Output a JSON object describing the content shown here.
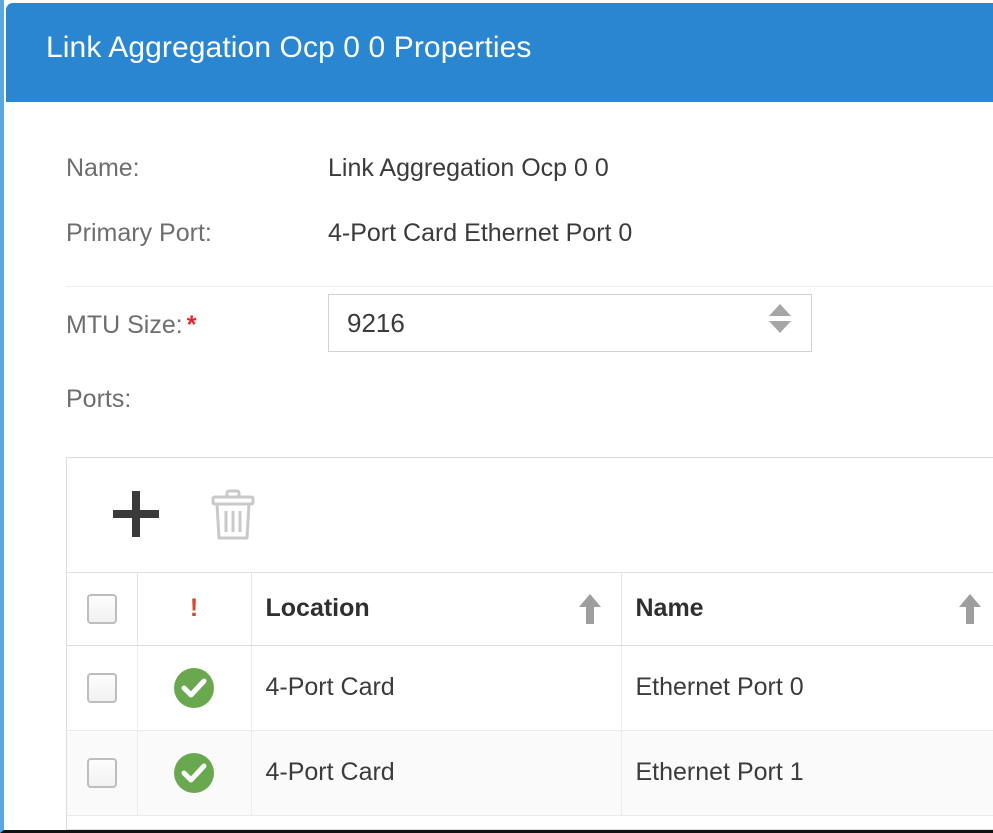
{
  "window": {
    "title": "Link Aggregation Ocp 0 0 Properties",
    "accent_color": "#2A86D1",
    "border_color": "#5BA8E0"
  },
  "form": {
    "name_label": "Name:",
    "name_value": "Link Aggregation Ocp 0 0",
    "primary_port_label": "Primary Port:",
    "primary_port_value": "4-Port Card Ethernet Port 0",
    "mtu_label": "MTU Size:",
    "mtu_required_marker": "*",
    "mtu_value": "9216",
    "mtu_placeholder": "",
    "required_color": "#E8232A"
  },
  "ports": {
    "section_label": "Ports:",
    "toolbar": {
      "add_icon": "plus-icon",
      "add_label": "Add",
      "delete_icon": "trash-icon",
      "delete_label": "Delete",
      "delete_enabled": false
    },
    "columns": [
      {
        "key": "select",
        "label": "",
        "icon": "header-select-checkbox",
        "sortable": false
      },
      {
        "key": "status",
        "label": "!",
        "sortable": false
      },
      {
        "key": "location",
        "label": "Location",
        "sortable": true,
        "sort": "asc"
      },
      {
        "key": "name",
        "label": "Name",
        "sortable": true,
        "sort": "asc"
      }
    ],
    "rows": [
      {
        "selected": false,
        "status": "ok",
        "status_color": "#6AA84F",
        "location": "4-Port Card",
        "name": "Ethernet Port 0"
      },
      {
        "selected": false,
        "status": "ok",
        "status_color": "#6AA84F",
        "location": "4-Port Card",
        "name": "Ethernet Port 1"
      }
    ]
  }
}
